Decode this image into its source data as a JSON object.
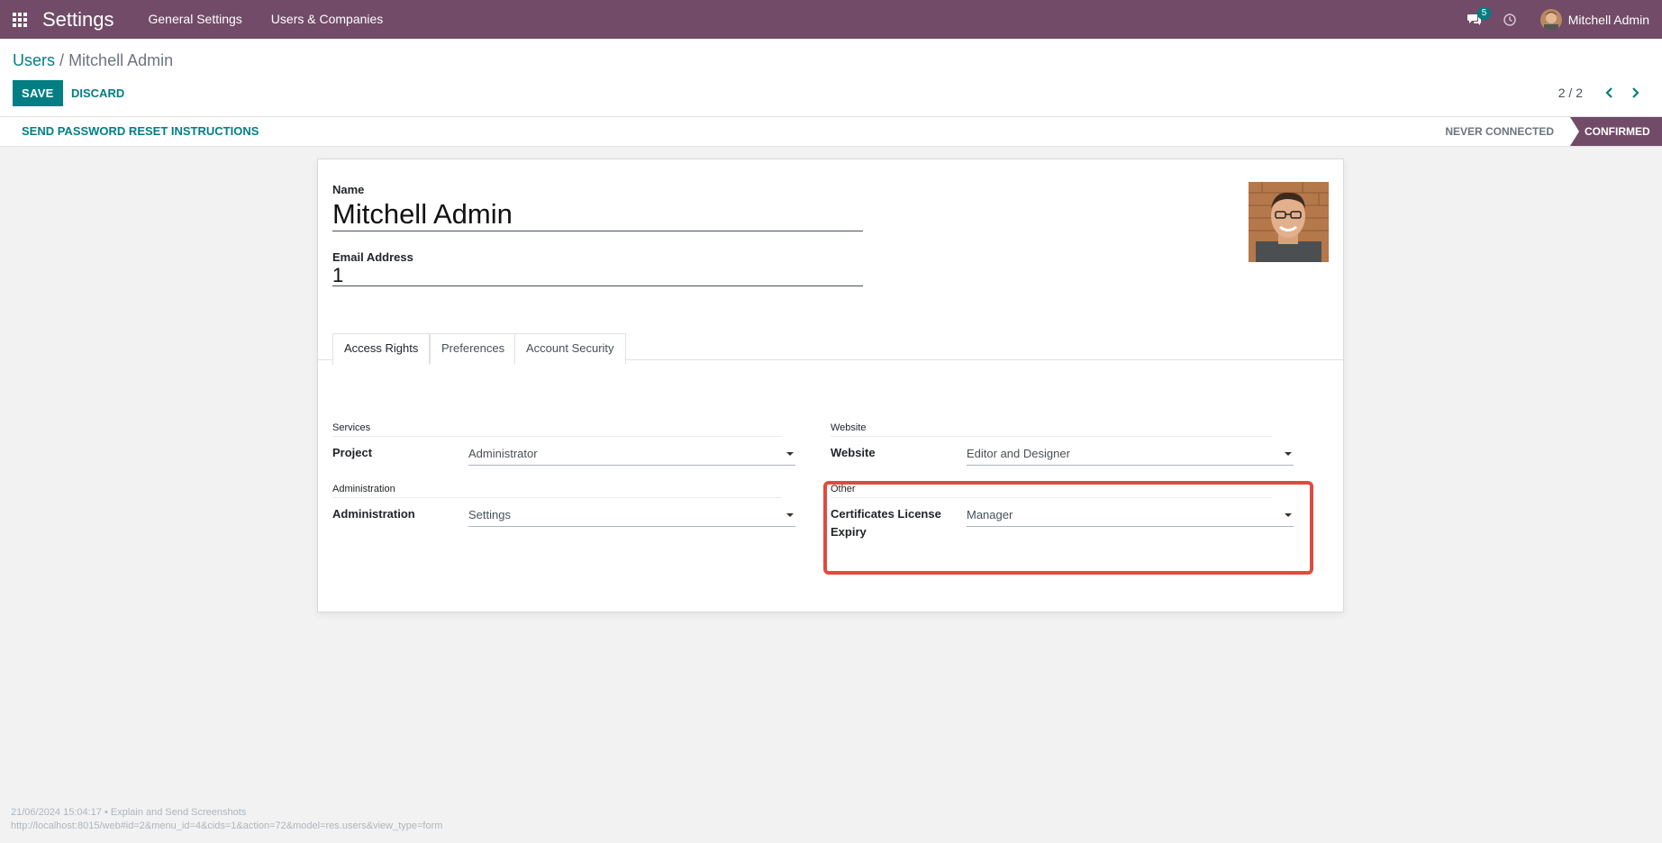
{
  "navbar": {
    "app_name": "Settings",
    "menus": [
      "General Settings",
      "Users & Companies"
    ],
    "chat_count": "5",
    "user_name": "Mitchell Admin"
  },
  "breadcrumb": {
    "parent": "Users",
    "separator": "/",
    "current": "Mitchell Admin"
  },
  "actions": {
    "save": "SAVE",
    "discard": "DISCARD"
  },
  "pager": {
    "value": "2 / 2"
  },
  "statusbar": {
    "reset_button": "SEND PASSWORD RESET INSTRUCTIONS",
    "stages": [
      "NEVER CONNECTED",
      "CONFIRMED"
    ],
    "active_stage": "CONFIRMED"
  },
  "form": {
    "name_label": "Name",
    "name_value": "Mitchell Admin",
    "email_label": "Email Address",
    "email_value": "1"
  },
  "tabs": [
    "Access Rights",
    "Preferences",
    "Account Security"
  ],
  "access_rights": {
    "services": {
      "title": "Services",
      "field_label": "Project",
      "field_value": "Administrator"
    },
    "administration": {
      "title": "Administration",
      "field_label": "Administration",
      "field_value": "Settings"
    },
    "website": {
      "title": "Website",
      "field_label": "Website",
      "field_value": "Editor and Designer"
    },
    "other": {
      "title": "Other",
      "field_label_line1": "Certificates License",
      "field_label_line2": "Expiry",
      "field_value": "Manager"
    }
  },
  "footer": {
    "line1": "21/06/2024 15:04:17 • Explain and Send Screenshots",
    "line2": "http://localhost:8015/web#id=2&menu_id=4&cids=1&action=72&model=res.users&view_type=form"
  },
  "colors": {
    "brand": "#714b67",
    "accent": "#017e84",
    "highlight": "#e04b3f"
  }
}
